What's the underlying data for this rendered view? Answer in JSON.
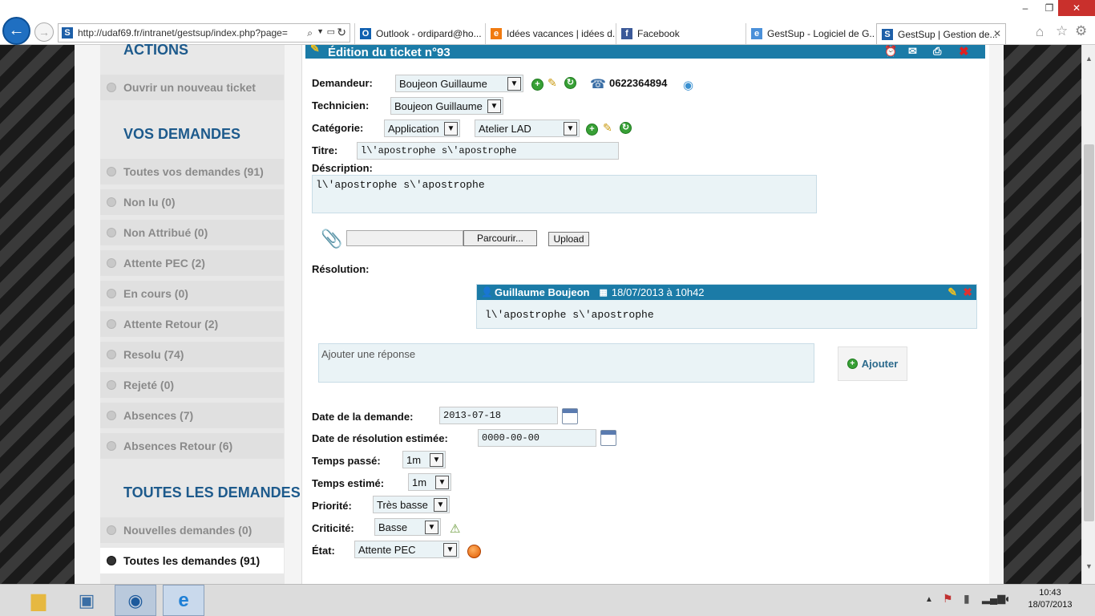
{
  "browser": {
    "address": "http://udaf69.fr/intranet/gestsup/index.php?page=",
    "tabs": [
      {
        "label": "Outlook - ordipard@ho..."
      },
      {
        "label": "Idées vacances | idées d..."
      },
      {
        "label": "Facebook"
      },
      {
        "label": "GestSup - Logiciel de G..."
      },
      {
        "label": "GestSup | Gestion de..."
      }
    ]
  },
  "sidebar": {
    "actions_heading": "ACTIONS",
    "new_ticket": "Ouvrir un nouveau ticket",
    "your_requests_heading": "VOS DEMANDES",
    "your_items": [
      "Toutes vos demandes (91)",
      "Non lu (0)",
      "Non Attribué (0)",
      "Attente PEC (2)",
      "En cours (0)",
      "Attente Retour (2)",
      "Resolu (74)",
      "Rejeté (0)",
      "Absences (7)",
      "Absences Retour (6)"
    ],
    "all_requests_heading": "TOUTES LES DEMANDES",
    "all_items": [
      "Nouvelles demandes (0)",
      "Toutes les demandes (91)"
    ]
  },
  "ticket": {
    "header_title": "Édition du ticket n°93",
    "labels": {
      "requester": "Demandeur:",
      "technician": "Technicien:",
      "category": "Catégorie:",
      "title": "Titre:",
      "description": "Déscription:",
      "resolution": "Résolution:",
      "date_request": "Date de la demande:",
      "date_resolution": "Date de résolution estimée:",
      "time_spent": "Temps passé:",
      "time_estimated": "Temps estimé:",
      "priority": "Priorité:",
      "criticality": "Criticité:",
      "state": "État:"
    },
    "requester": "Boujeon Guillaume",
    "requester_phone": "0622364894",
    "technician": "Boujeon Guillaume",
    "category": "Application",
    "subcategory": "Atelier LAD",
    "title": "l\\'apostrophe s\\'apostrophe",
    "description": "l\\'apostrophe s\\'apostrophe",
    "browse_label": "Parcourir...",
    "upload_label": "Upload",
    "resolution_entry": {
      "author": "Guillaume Boujeon",
      "datetime": "18/07/2013 à 10h42",
      "text": "l\\'apostrophe s\\'apostrophe"
    },
    "reply_placeholder": "Ajouter une réponse",
    "add_label": "Ajouter",
    "date_request": "2013-07-18",
    "date_resolution": "0000-00-00",
    "time_spent": "1m",
    "time_estimated": "1m",
    "priority": "Très basse",
    "criticality": "Basse",
    "state": "Attente PEC"
  },
  "taskbar": {
    "time": "10:43",
    "date": "18/07/2013"
  }
}
